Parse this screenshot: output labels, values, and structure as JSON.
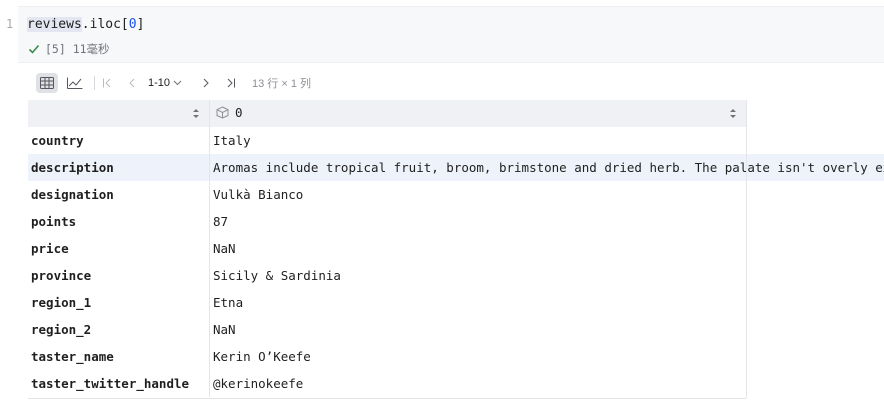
{
  "cell": {
    "line_number": "1",
    "code": {
      "part1": "reviews",
      "part2": ".iloc[",
      "index": "0",
      "part3": "]"
    },
    "status": "[5] 11毫秒"
  },
  "toolbar": {
    "range": "1-10",
    "shape": "13 行 × 1 列"
  },
  "table": {
    "column_header": "0",
    "rows": [
      {
        "index": "country",
        "value": "Italy"
      },
      {
        "index": "description",
        "value": "Aromas include tropical fruit, broom, brimstone and dried herb. The palate isn't overly expressive, offering unripened apple, citrus and dried sage alongside brisk acidity."
      },
      {
        "index": "designation",
        "value": "Vulkà Bianco"
      },
      {
        "index": "points",
        "value": "87"
      },
      {
        "index": "price",
        "value": "NaN"
      },
      {
        "index": "province",
        "value": "Sicily & Sardinia"
      },
      {
        "index": "region_1",
        "value": "Etna"
      },
      {
        "index": "region_2",
        "value": "NaN"
      },
      {
        "index": "taster_name",
        "value": "Kerin O’Keefe"
      },
      {
        "index": "taster_twitter_handle",
        "value": "@kerinokeefe"
      }
    ]
  },
  "colors": {
    "accent": "#1750eb",
    "success": "#3a8a4a",
    "header_bg": "#f0f1f4",
    "selected_row": "#eef3fb"
  },
  "icons": [
    "check-icon",
    "table-icon",
    "chart-icon",
    "first-page-icon",
    "prev-page-icon",
    "chevron-down-icon",
    "next-page-icon",
    "last-page-icon",
    "sort-icon",
    "cube-icon"
  ]
}
